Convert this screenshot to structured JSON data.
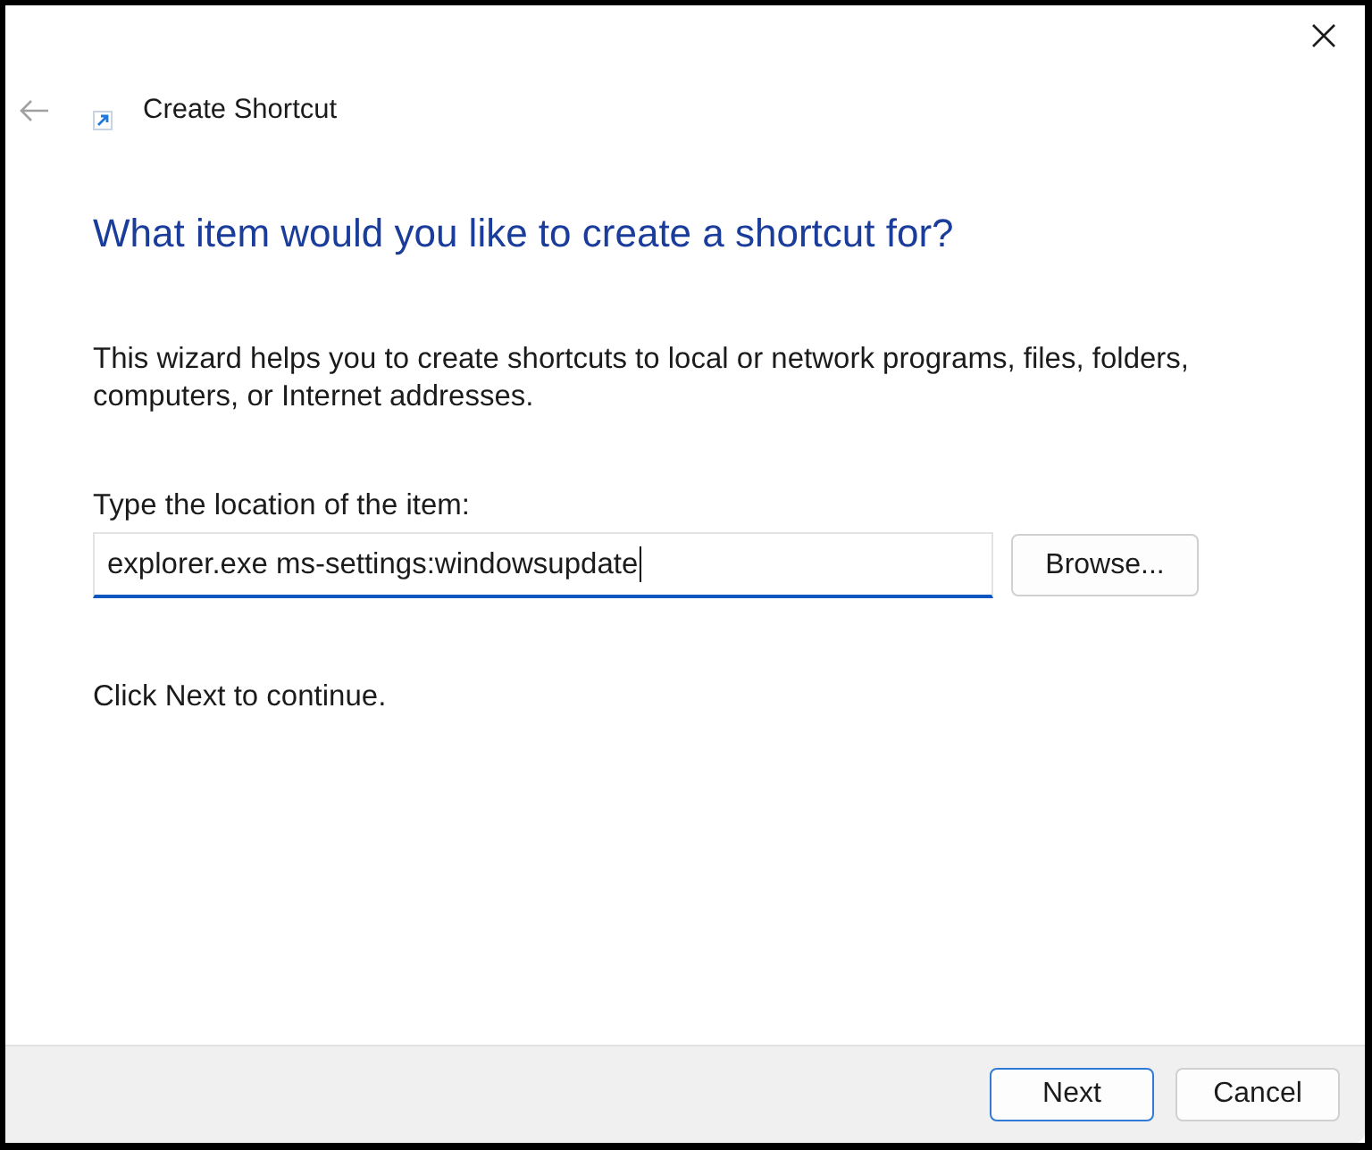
{
  "header": {
    "title": "Create Shortcut",
    "back_disabled": true
  },
  "heading": "What item would you like to create a shortcut for?",
  "description": "This wizard helps you to create shortcuts to local or network programs, files, folders, computers, or Internet addresses.",
  "location": {
    "label": "Type the location of the item:",
    "value": "explorer.exe ms-settings:windowsupdate",
    "focused": true
  },
  "browse_button": "Browse...",
  "hint": "Click Next to continue.",
  "buttons": [
    {
      "label": "Next",
      "default": true
    },
    {
      "label": "Cancel",
      "default": false
    }
  ]
}
